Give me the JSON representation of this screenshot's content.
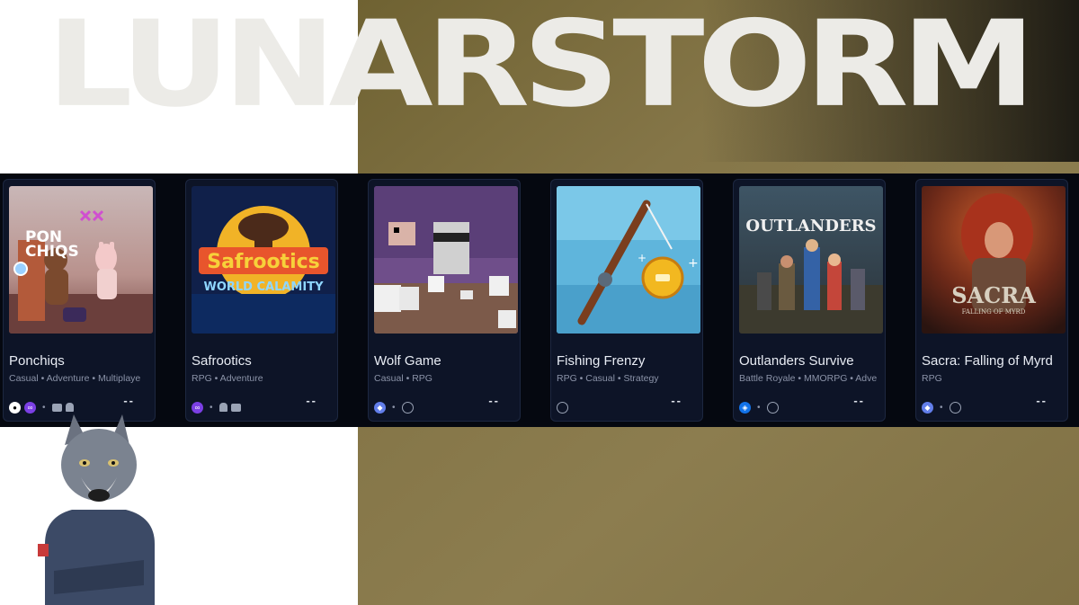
{
  "brand": {
    "name": "LUNARSTORM"
  },
  "games": [
    {
      "title": "Ponchiqs",
      "genres": "Casual • Adventure • Multiplaye",
      "status": "--",
      "art_text": "PONCHIQS",
      "icons": [
        "github-icon",
        "polygon-icon",
        "vr-icon",
        "android-icon"
      ]
    },
    {
      "title": "Safrootics",
      "genres": "RPG • Adventure",
      "status": "--",
      "art_text": "Safrootics",
      "art_sub": "WORLD CALAMITY",
      "icons": [
        "polygon-icon",
        "android-icon",
        "vr-icon"
      ]
    },
    {
      "title": "Wolf Game",
      "genres": "Casual • RPG",
      "status": "--",
      "icons": [
        "ethereum-icon",
        "globe-icon"
      ]
    },
    {
      "title": "Fishing Frenzy",
      "genres": "RPG • Casual • Strategy",
      "status": "--",
      "icons": [
        "globe-icon"
      ]
    },
    {
      "title": "Outlanders Survive",
      "genres": "Battle Royale • MMORPG • Adve",
      "status": "--",
      "art_text": "OUTLANDERS",
      "icons": [
        "ronin-icon",
        "globe-icon"
      ]
    },
    {
      "title": "Sacra: Falling of Myrd",
      "genres": "RPG",
      "status": "--",
      "art_text": "SACRA",
      "art_sub": "FALLING OF MYRD",
      "icons": [
        "ethereum-icon",
        "globe-icon"
      ]
    }
  ],
  "colors": {
    "background_gold": "#857648",
    "strip": "#050810",
    "card": "#0d1427",
    "title_text": "#e8ecf4",
    "muted_text": "#8b93a8"
  }
}
